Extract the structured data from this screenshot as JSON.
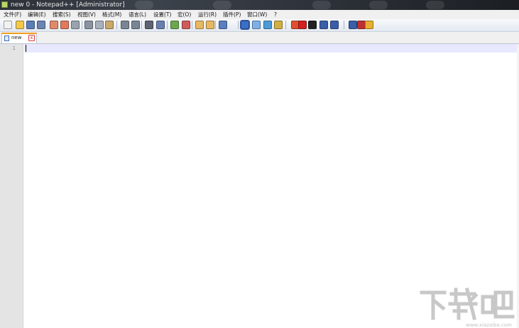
{
  "window": {
    "title": "new  0 - Notepad++ [Administrator]"
  },
  "menu": {
    "items": [
      "文件(F)",
      "编辑(E)",
      "搜索(S)",
      "视图(V)",
      "格式(M)",
      "语言(L)",
      "设置(T)",
      "宏(O)",
      "运行(R)",
      "插件(P)",
      "窗口(W)",
      "?"
    ]
  },
  "toolbar": {
    "buttons": [
      {
        "icon": "new-file-icon",
        "color": "#f2f2f2"
      },
      {
        "icon": "open-file-icon",
        "color": "#f2c84b"
      },
      {
        "icon": "save-icon",
        "color": "#5b7fb8"
      },
      {
        "icon": "save-all-icon",
        "color": "#6a86b0"
      },
      {
        "icon": "close-icon",
        "color": "#e08a6a"
      },
      {
        "icon": "close-all-icon",
        "color": "#e07a5a"
      },
      {
        "icon": "print-icon",
        "color": "#9aa3ad"
      },
      {
        "icon": "cut-icon",
        "color": "#8a94a0"
      },
      {
        "icon": "copy-icon",
        "color": "#a8b0ba"
      },
      {
        "icon": "paste-icon",
        "color": "#c9a86a"
      },
      {
        "icon": "undo-icon",
        "color": "#7a8594"
      },
      {
        "icon": "redo-icon",
        "color": "#7a8594"
      },
      {
        "icon": "find-icon",
        "color": "#5c6470"
      },
      {
        "icon": "replace-icon",
        "color": "#6a7fb0"
      },
      {
        "icon": "zoom-in-icon",
        "color": "#6aa84f"
      },
      {
        "icon": "zoom-out-icon",
        "color": "#d05a5a"
      },
      {
        "icon": "sync-vertical-icon",
        "color": "#e8b860"
      },
      {
        "icon": "sync-horizontal-icon",
        "color": "#e8b860"
      },
      {
        "icon": "word-wrap-icon",
        "color": "#5a7fc0"
      },
      {
        "icon": "show-all-chars-icon",
        "color": "#3a6fc8"
      },
      {
        "icon": "indent-guide-icon",
        "color": "#7db0e8"
      },
      {
        "icon": "doc-map-icon",
        "color": "#4c9bd8"
      },
      {
        "icon": "function-list-icon",
        "color": "#d0b040"
      },
      {
        "icon": "folder-workspace-icon",
        "color": "#e05030"
      },
      {
        "icon": "record-macro-icon",
        "color": "#d02020"
      },
      {
        "icon": "stop-macro-icon",
        "color": "#222222"
      },
      {
        "icon": "play-macro-icon",
        "color": "#3a5ea8"
      },
      {
        "icon": "play-multiple-icon",
        "color": "#3a5ea8"
      },
      {
        "icon": "save-macro-icon",
        "color": "#3a5ea8"
      },
      {
        "icon": "spell-check-icon",
        "color": "#c03030"
      },
      {
        "icon": "plugin-icon",
        "color": "#e8b030"
      }
    ]
  },
  "tab": {
    "label": "new",
    "close_symbol": "x"
  },
  "editor": {
    "line_number": "1",
    "caret_line_color": "#e8e8ff"
  },
  "watermark": {
    "text": "下载吧",
    "sub": "www.xiazaiba.com"
  }
}
